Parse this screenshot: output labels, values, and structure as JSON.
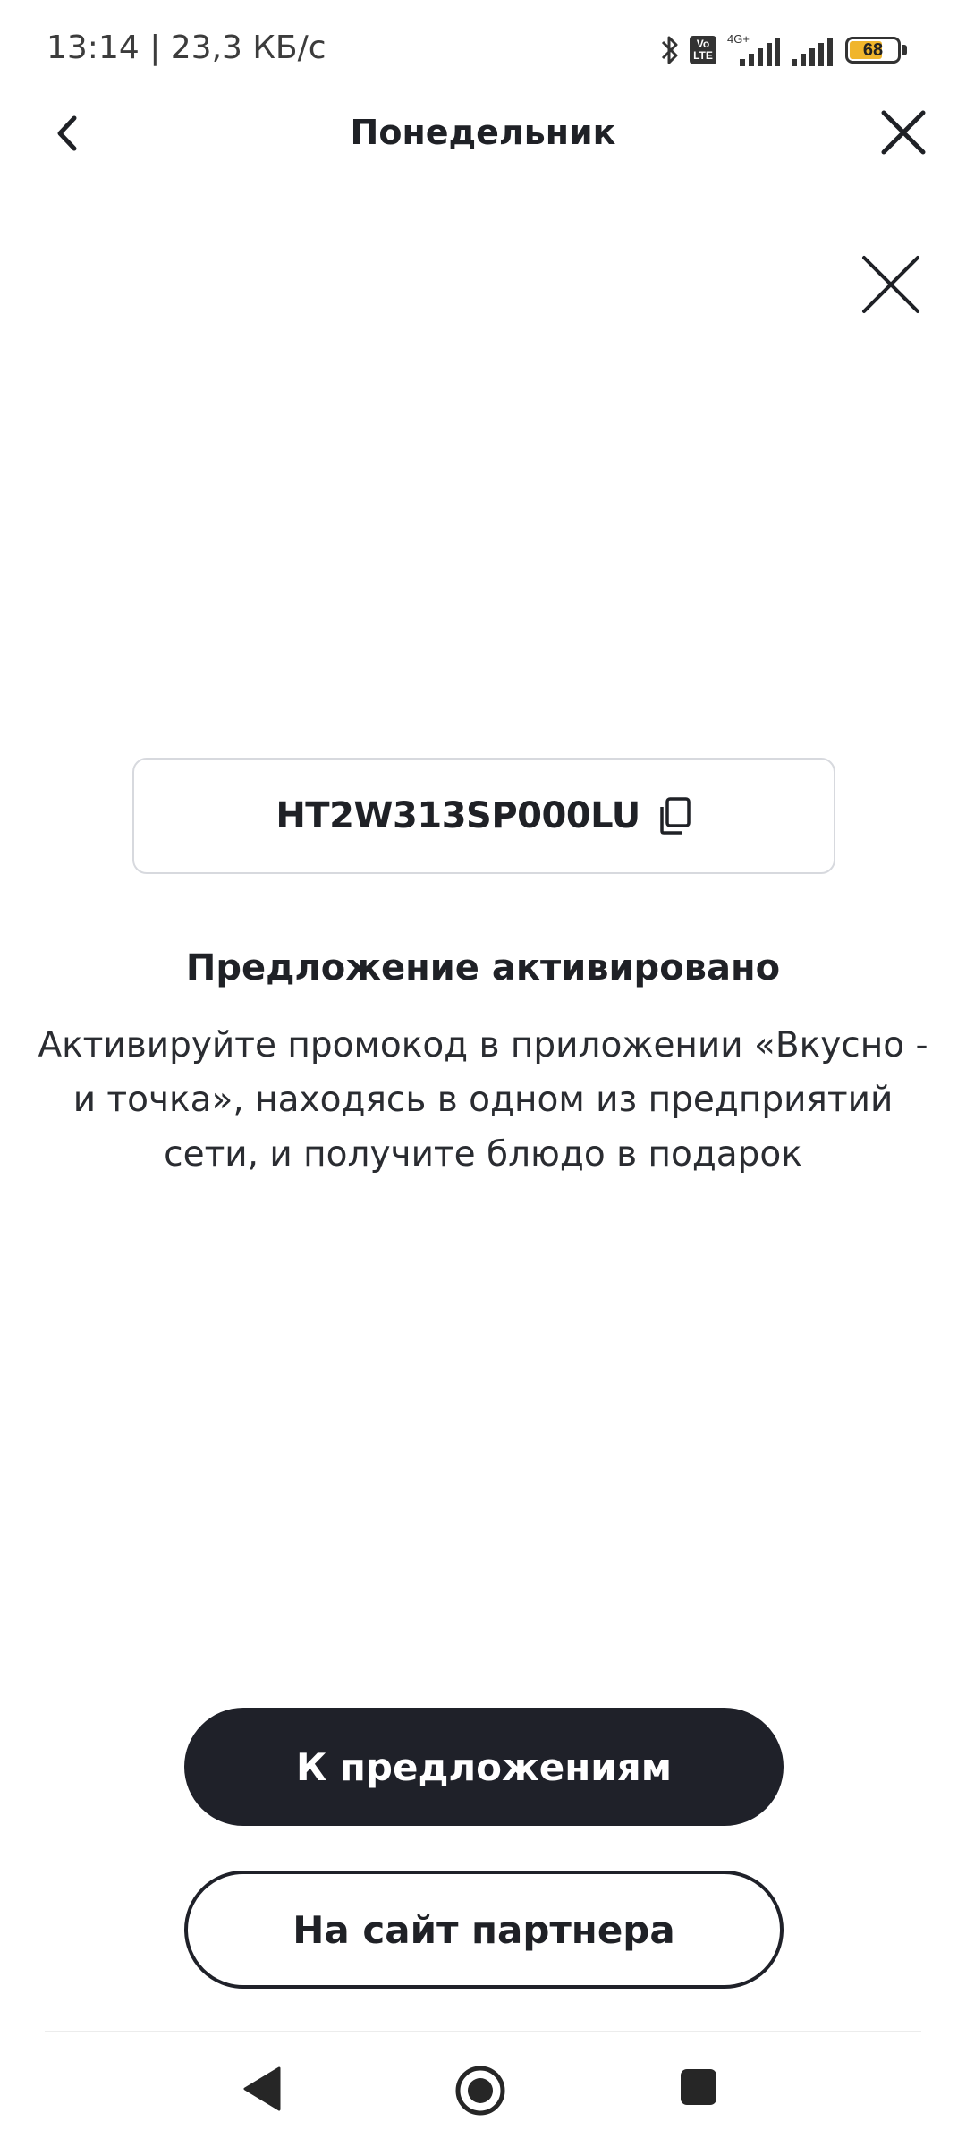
{
  "status_bar": {
    "time_speed": "13:14 | 23,3 КБ/с",
    "network": "4G+",
    "volte": "Vo LTE",
    "battery": "68"
  },
  "header": {
    "title": "Понедельник",
    "back_icon": "chevron-left-icon",
    "close_icon": "close-icon"
  },
  "promo": {
    "code": "HT2W313SP000LU",
    "copy_icon": "copy-icon"
  },
  "offer": {
    "title": "Предложение активировано",
    "description": "Активируйте промокод в приложении «Вкусно - и точка», находясь в одном из предприятий сети, и получите блюдо в подарок"
  },
  "buttons": {
    "primary": "К предложениям",
    "secondary": "На сайт партнера"
  },
  "nav_bar": {
    "back_icon": "triangle-back-icon",
    "home_icon": "circle-home-icon",
    "recents_icon": "square-recents-icon"
  },
  "colors": {
    "primary": "#1f2129",
    "battery": "#f0b52c",
    "border": "#d7d9de"
  }
}
